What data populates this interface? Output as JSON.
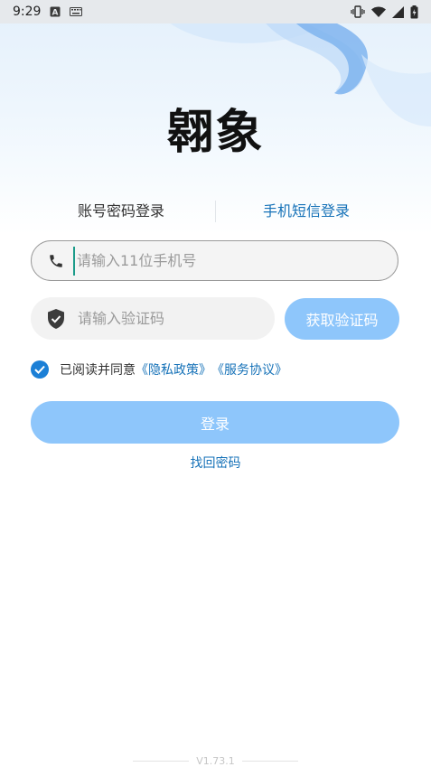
{
  "status_bar": {
    "time": "9:29",
    "left_icons": [
      "a-notification-icon",
      "keyboard-icon"
    ],
    "right_icons": [
      "vibrate-icon",
      "wifi-icon",
      "signal-icon",
      "battery-icon"
    ]
  },
  "app": {
    "logo_text": "翱象"
  },
  "tabs": {
    "password_login": "账号密码登录",
    "sms_login": "手机短信登录",
    "active": "sms_login"
  },
  "form": {
    "phone": {
      "placeholder": "请输入11位手机号",
      "value": ""
    },
    "code": {
      "placeholder": "请输入验证码",
      "value": ""
    },
    "get_code_button": "获取验证码",
    "agreement": {
      "checked": true,
      "prefix": "已阅读并同意",
      "privacy_link": "《隐私政策》",
      "service_link": "《服务协议》"
    },
    "login_button": "登录",
    "forgot_password": "找回密码"
  },
  "footer": {
    "version": "V1.73.1"
  },
  "colors": {
    "accent": "#1672b8",
    "button_disabled": "#8ec6fb",
    "checkbox": "#1b7fd6"
  }
}
